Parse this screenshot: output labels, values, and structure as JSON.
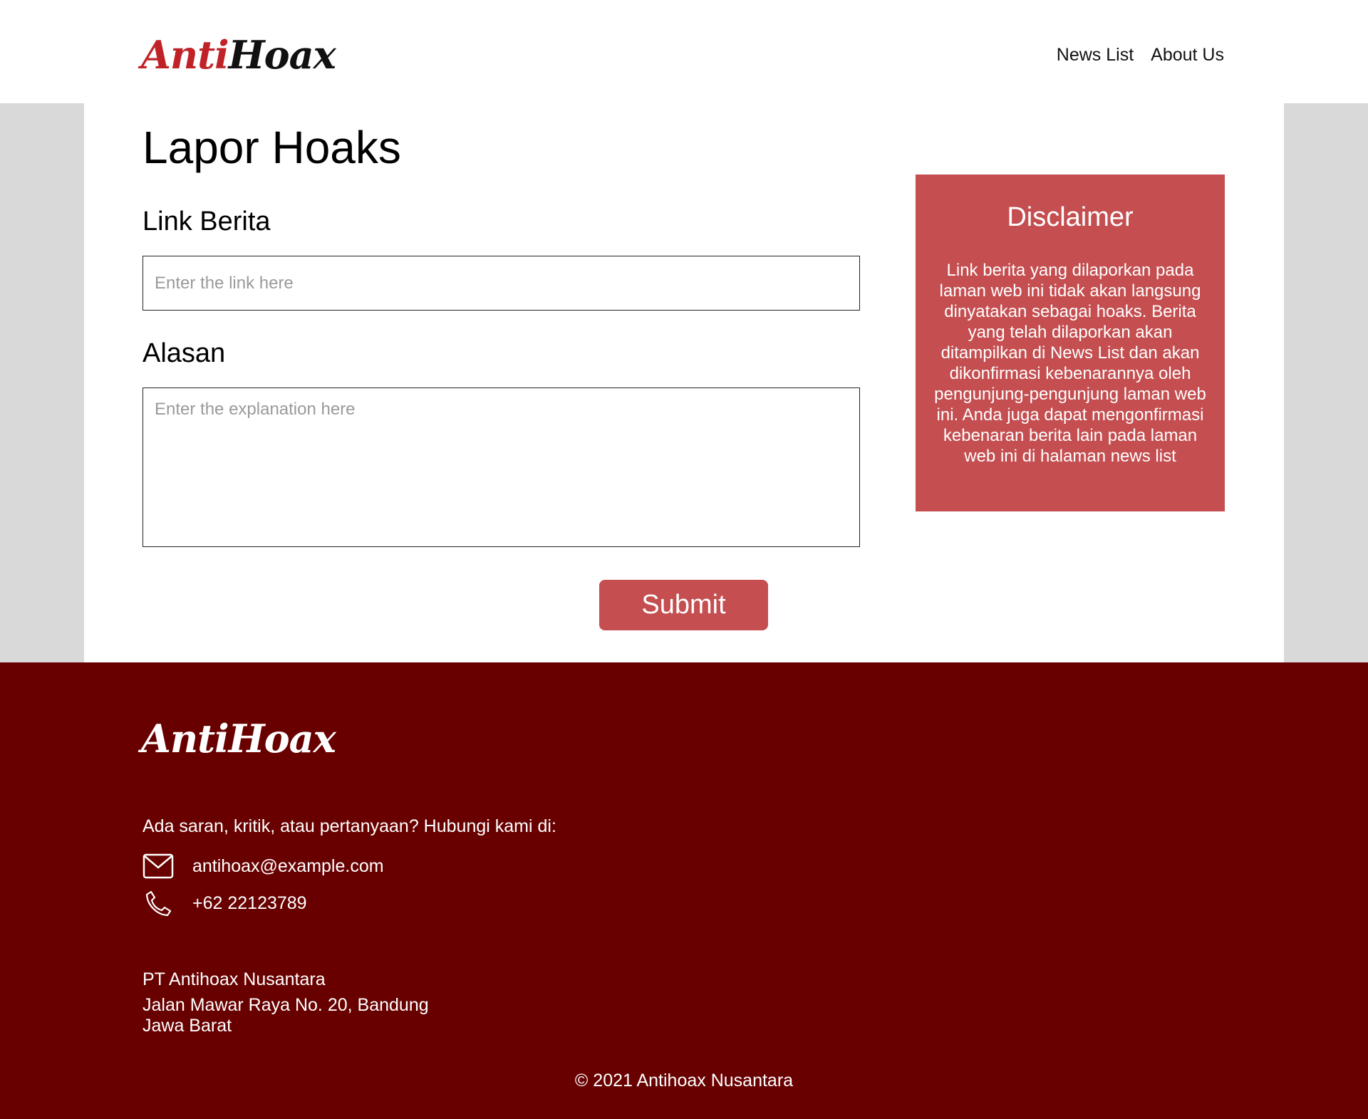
{
  "header": {
    "logo_anti": "Anti",
    "logo_hoax": "Hoax",
    "nav": [
      "News List",
      "About Us"
    ]
  },
  "main": {
    "title": "Lapor Hoaks",
    "link_label": "Link Berita",
    "link_placeholder": "Enter the link here",
    "reason_label": "Alasan",
    "reason_placeholder": "Enter the explanation here",
    "submit_label": "Submit"
  },
  "disclaimer": {
    "title": "Disclaimer",
    "text": "Link berita yang dilaporkan pada laman web ini tidak akan langsung dinyatakan sebagai hoaks. Berita yang telah dilaporkan akan ditampilkan di News List dan akan dikonfirmasi kebenarannya oleh pengunjung-pengunjung laman web ini. Anda juga dapat mengonfirmasi kebenaran berita lain pada laman web ini di halaman news list"
  },
  "footer": {
    "logo": "AntiHoax",
    "contact_intro": "Ada saran, kritik, atau pertanyaan? Hubungi kami di:",
    "email": "antihoax@example.com",
    "phone": "+62 22123789",
    "company": "PT Antihoax Nusantara",
    "address_line1": "Jalan Mawar Raya No. 20, Bandung",
    "address_line2": "Jawa Barat",
    "copyright": "© 2021 Antihoax Nusantara"
  },
  "icons": {
    "email": "mail-icon",
    "phone": "phone-icon"
  },
  "colors": {
    "brand_red": "#c02327",
    "accent": "#c44e50",
    "footer_bg": "#680000",
    "band_bg": "#d9d9d9"
  }
}
